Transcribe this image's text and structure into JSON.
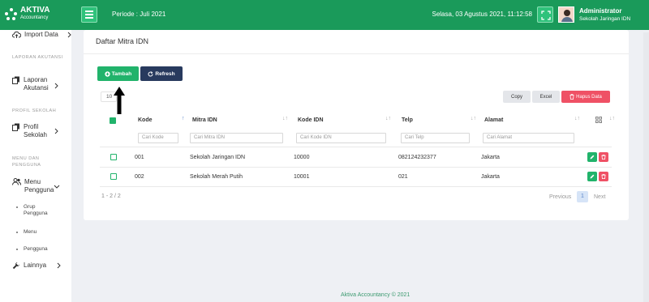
{
  "header": {
    "app_name": "AKTIVA",
    "app_sub": "Accountancy",
    "periode": "Periode : Juli 2021",
    "datetime": "Selasa, 03 Agustus 2021, 11:12:58",
    "user_name": "Administrator",
    "user_school": "Sekolah Jaringan IDN"
  },
  "sidebar": {
    "import": "Import Data",
    "section_laporan": "LAPORAN AKUTANSI",
    "laporan_line1": "Laporan",
    "laporan_line2": "Akutansi",
    "section_profil": "PROFIL SEKOLAH",
    "profil_line1": "Profil",
    "profil_line2": "Sekolah",
    "section_menu_line1": "MENU DAN",
    "section_menu_line2": "PENGGUNA",
    "menu_line1": "Menu",
    "menu_line2": "Pengguna",
    "sub_grup_line1": "Grup",
    "sub_grup_line2": "Pengguna",
    "sub_menu": "Menu",
    "sub_pengguna": "Pengguna",
    "lainnya": "Lainnya"
  },
  "card": {
    "title": "Daftar Mitra IDN",
    "btn_tambah": "Tambah",
    "btn_refresh": "Refresh",
    "length_value": "10",
    "btn_copy": "Copy",
    "btn_excel": "Excel",
    "btn_hapus": "Hapus Data"
  },
  "table": {
    "headers": [
      "Kode",
      "Mitra IDN",
      "Kode IDN",
      "Telp",
      "Alamat"
    ],
    "filters": [
      "Cari Kode",
      "Cari Mitra IDN",
      "Cari Kode IDN",
      "Cari Telp",
      "Cari Alamat"
    ],
    "rows": [
      [
        "001",
        "Sekolah Jaringan IDN",
        "10000",
        "082124232377",
        "Jakarta"
      ],
      [
        "002",
        "Sekolah Merah Putih",
        "10001",
        "021",
        "Jakarta"
      ]
    ],
    "info": "1 - 2 / 2",
    "prev": "Previous",
    "current_page": "1",
    "next": "Next"
  },
  "footer": "Aktiva Accountancy © 2021",
  "colors": {
    "primary": "#1a9a5a",
    "accent": "#21b36b",
    "navy": "#283a5e",
    "danger": "#ef5165"
  }
}
